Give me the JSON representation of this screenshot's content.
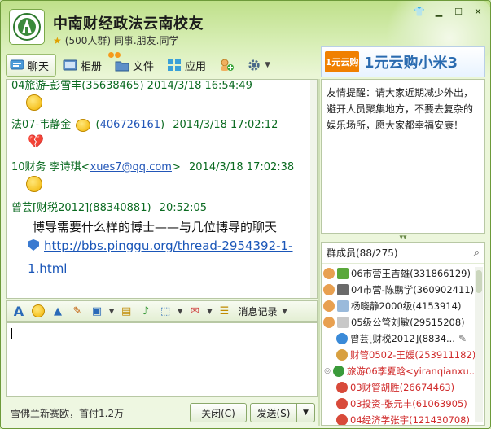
{
  "header": {
    "title": "中南财经政法云南校友",
    "subtitle": "(500人群) 同事.朋友.同学"
  },
  "toolbar": {
    "tabs": [
      {
        "label": "聊天",
        "icon": "chat-icon",
        "active": true
      },
      {
        "label": "相册",
        "icon": "album-icon"
      },
      {
        "label": "文件",
        "icon": "folder-icon"
      },
      {
        "label": "应用",
        "icon": "apps-icon"
      }
    ]
  },
  "ad": {
    "logo_text": "1元云购",
    "text": "1元云购小米3"
  },
  "chat": {
    "messages": [
      {
        "text": "04旅游-彭雪丰(35638465) 2014/3/18 16:54:49"
      },
      {
        "sender": "法07-韦静金",
        "link": "406726161",
        "time": "2014/3/18 17:02:12"
      },
      {
        "sender": "10财务 李诗琪<",
        "link": "xues7@qq.com",
        "suffix": ">",
        "time": "2014/3/18 17:02:38"
      },
      {
        "sender": "曾芸[财税2012](88340881)",
        "time": "20:52:05"
      }
    ],
    "body_text": "博导需要什么样的博士——与几位博导的聊天",
    "link_line1": "http://bbs.pinggu.org/thread-2954392-1-",
    "link_line2": "1.html"
  },
  "chat_toolbar": {
    "history_label": "消息记录"
  },
  "bottom": {
    "ad_text": "雪佛兰新赛欧，首付1.2万",
    "close_label": "关闭(C)",
    "send_label": "发送(S)"
  },
  "notice": {
    "text": "友情提醒：请大家近期减少外出，避开人员聚集地方，不要去复杂的娱乐场所，愿大家都幸福安康！"
  },
  "members": {
    "title": "群成员(88/275)",
    "list": [
      {
        "name": "06市营王吉雄(331866129)",
        "color": "#222222"
      },
      {
        "name": "04市营-陈鹏学(360902411)",
        "color": "#222222"
      },
      {
        "name": "杨晓静2000级(4153914)",
        "color": "#222222"
      },
      {
        "name": "05级公管刘敏(29515208)",
        "color": "#222222"
      },
      {
        "name": "曾芸[财税2012](8834...",
        "color": "#222222"
      },
      {
        "name": "财管0502-王媛(253911182)",
        "color": "#d02b2b"
      },
      {
        "name": "旅游06李夏晗<yiranqianxu...",
        "color": "#d02b2b"
      },
      {
        "name": "03财管胡胜(26674463)",
        "color": "#d02b2b"
      },
      {
        "name": "03投资-张元丰(61063905)",
        "color": "#d02b2b"
      },
      {
        "name": "04经济学张宇(121430708)",
        "color": "#d02b2b"
      }
    ]
  },
  "colors": {
    "accent": "#6d9a3a",
    "link": "#2256b8",
    "sender": "#0a6a20",
    "member_highlight": "#d02b2b"
  }
}
